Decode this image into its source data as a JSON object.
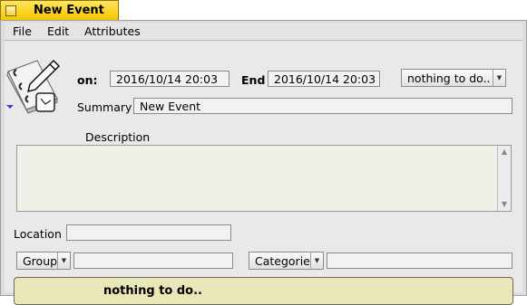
{
  "window": {
    "title": "New Event"
  },
  "menu": [
    "File",
    "Edit",
    "Attributes"
  ],
  "event": {
    "on_label": "on:",
    "start": "2016/10/14 20:03",
    "end_label": "End",
    "end": "2016/10/14 20:03",
    "reminder": "nothing to do..",
    "summary_label": "Summary",
    "summary": "New Event",
    "description_label": "Description",
    "description": "",
    "location_label": "Location",
    "location": "",
    "group_label": "Group",
    "group_value": "",
    "category_label": "Categorie",
    "category_value": ""
  },
  "status": "nothing to do..",
  "icons": {
    "app": "notebook-pencil-clock-icon",
    "dropdown": "chevron-down-icon"
  }
}
